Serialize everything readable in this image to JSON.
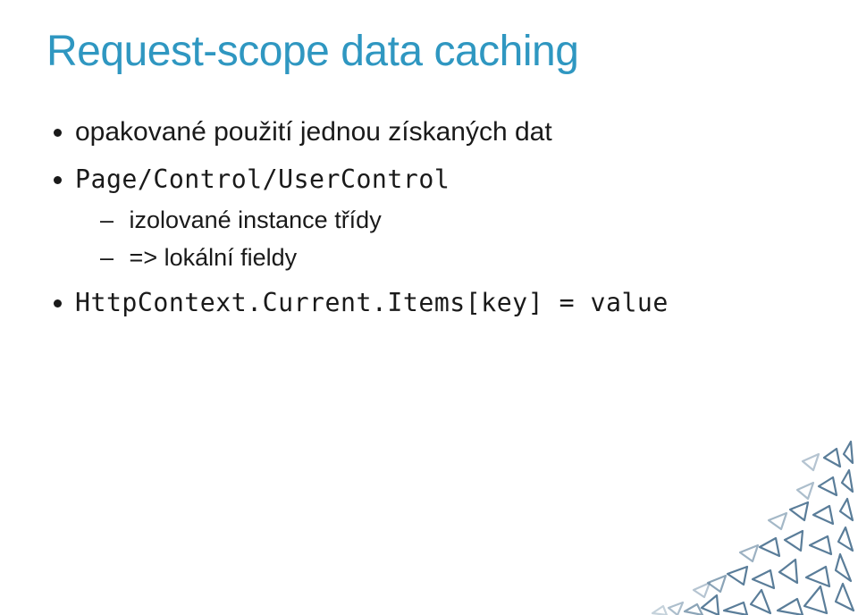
{
  "title": "Request-scope data caching",
  "bullets": {
    "b1": "opakované použití jednou získaných dat",
    "b2": "Page/Control/UserControl",
    "b2sub": {
      "s1": "izolované instance třídy",
      "s2": "=> lokální fieldy"
    },
    "b3": "HttpContext.Current.Items[key] = value"
  },
  "deco": {
    "icon": "triangle-pattern"
  }
}
